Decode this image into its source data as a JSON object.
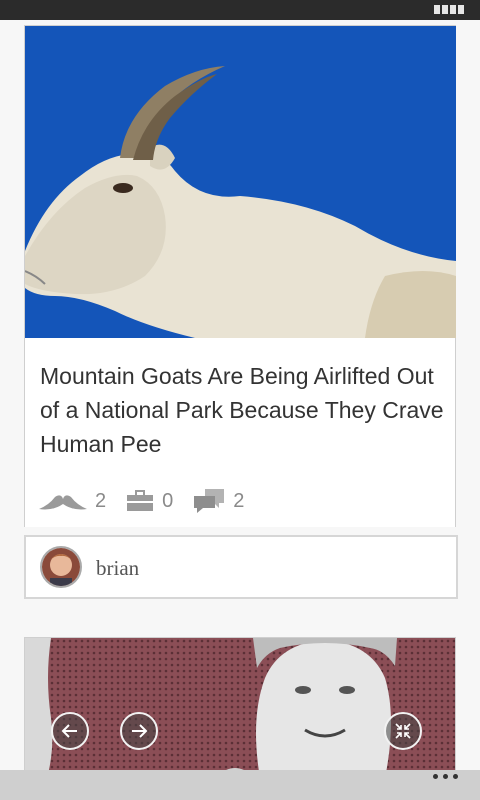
{
  "article": {
    "title": "Mountain Goats Are Being Airlifted Out of a National Park Because They Crave Human Pee",
    "stats": {
      "likes": "2",
      "saves": "0",
      "comments": "2"
    }
  },
  "author": {
    "name": "brian"
  },
  "icons": {
    "likes": "mustache-icon",
    "saves": "briefcase-icon",
    "comments": "comment-icon",
    "prev": "arrow-left-icon",
    "next": "arrow-right-icon",
    "collapse": "collapse-icon",
    "more": "overflow-menu-icon"
  },
  "colors": {
    "sky": "#1455b9",
    "halftone": "#8b4e56",
    "statusbar": "#2b2b2b",
    "bottombar": "#cfcfcf"
  }
}
